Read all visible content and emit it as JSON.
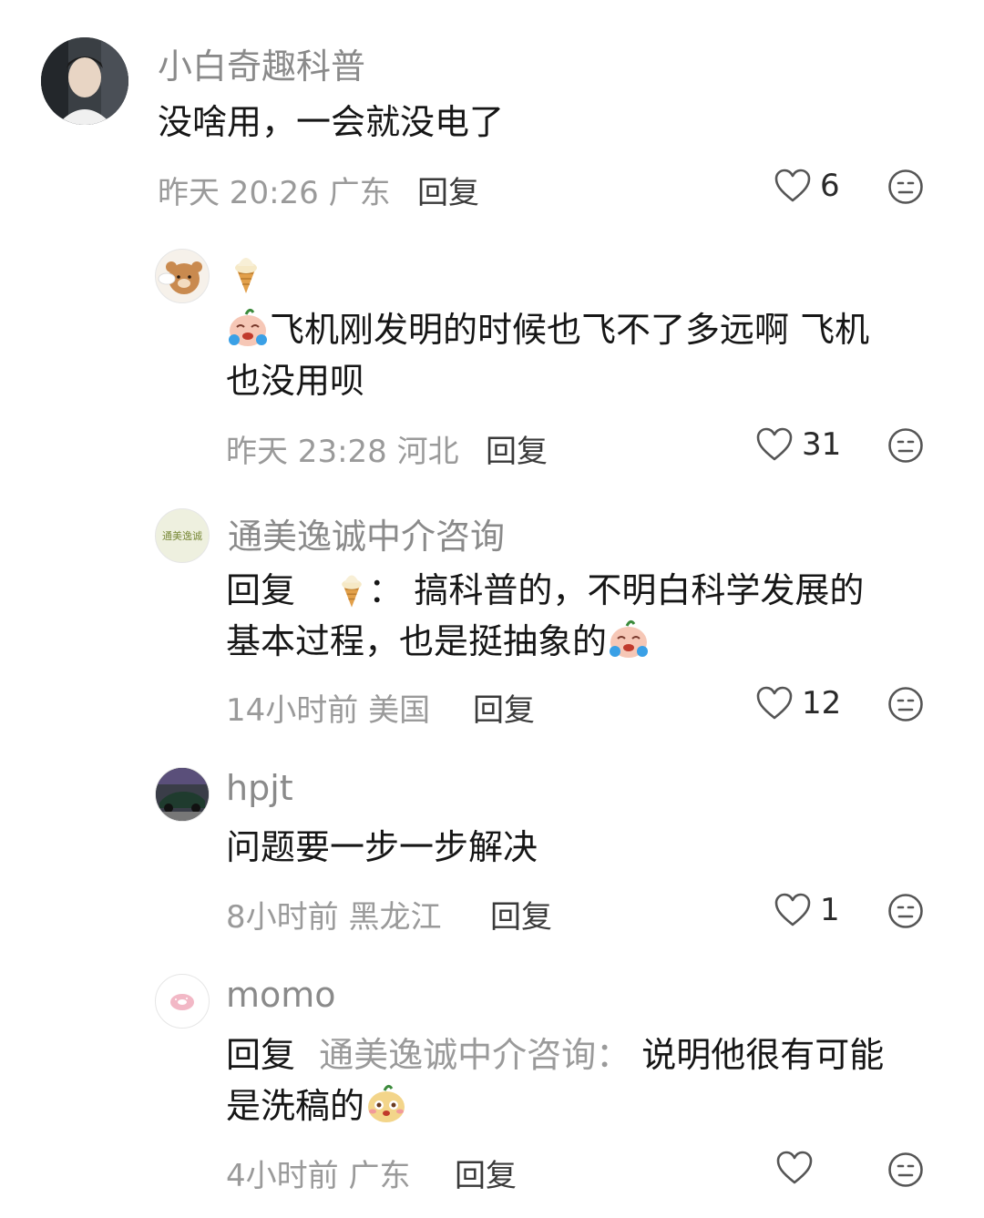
{
  "comments": [
    {
      "user": "小白奇趣科普",
      "text": "没啥用，一会就没电了",
      "time": "昨天 20:26",
      "location": "广东",
      "reply_label": "回复",
      "likes": "6"
    },
    {
      "user": "🍦",
      "text_line1": "飞机刚发明的时候也飞不了多远啊 飞机",
      "text_line2": "也没用呗",
      "time": "昨天 23:28",
      "location": "河北",
      "reply_label": "回复",
      "likes": "31"
    },
    {
      "user": "通美逸诚中介咨询",
      "avatar_text": "通美逸诚",
      "reply_prefix": "回复",
      "reply_to": "🍦",
      "colon": "：",
      "text_line1": "搞科普的，不明白科学发展的",
      "text_line2": "基本过程，也是挺抽象的",
      "time": "14小时前",
      "location": "美国",
      "reply_label": "回复",
      "likes": "12"
    },
    {
      "user": "hpjt",
      "text": "问题要一步一步解决",
      "time": "8小时前",
      "location": "黑龙江",
      "reply_label": "回复",
      "likes": "1"
    },
    {
      "user": "momo",
      "reply_prefix": "回复",
      "reply_to": "通美逸诚中介咨询",
      "colon": "：",
      "text_line1": "说明他很有可能",
      "text_line2": "是洗稿的",
      "time": "4小时前",
      "location": "广东",
      "reply_label": "回复",
      "likes": ""
    }
  ],
  "colors": {
    "name": "#8a8a8a",
    "meta": "#9a9a9a",
    "text": "#161616",
    "icon": "#555555"
  },
  "icons": [
    "heart-icon",
    "dislike-face-icon",
    "crying-emoji",
    "cute-emoji"
  ]
}
